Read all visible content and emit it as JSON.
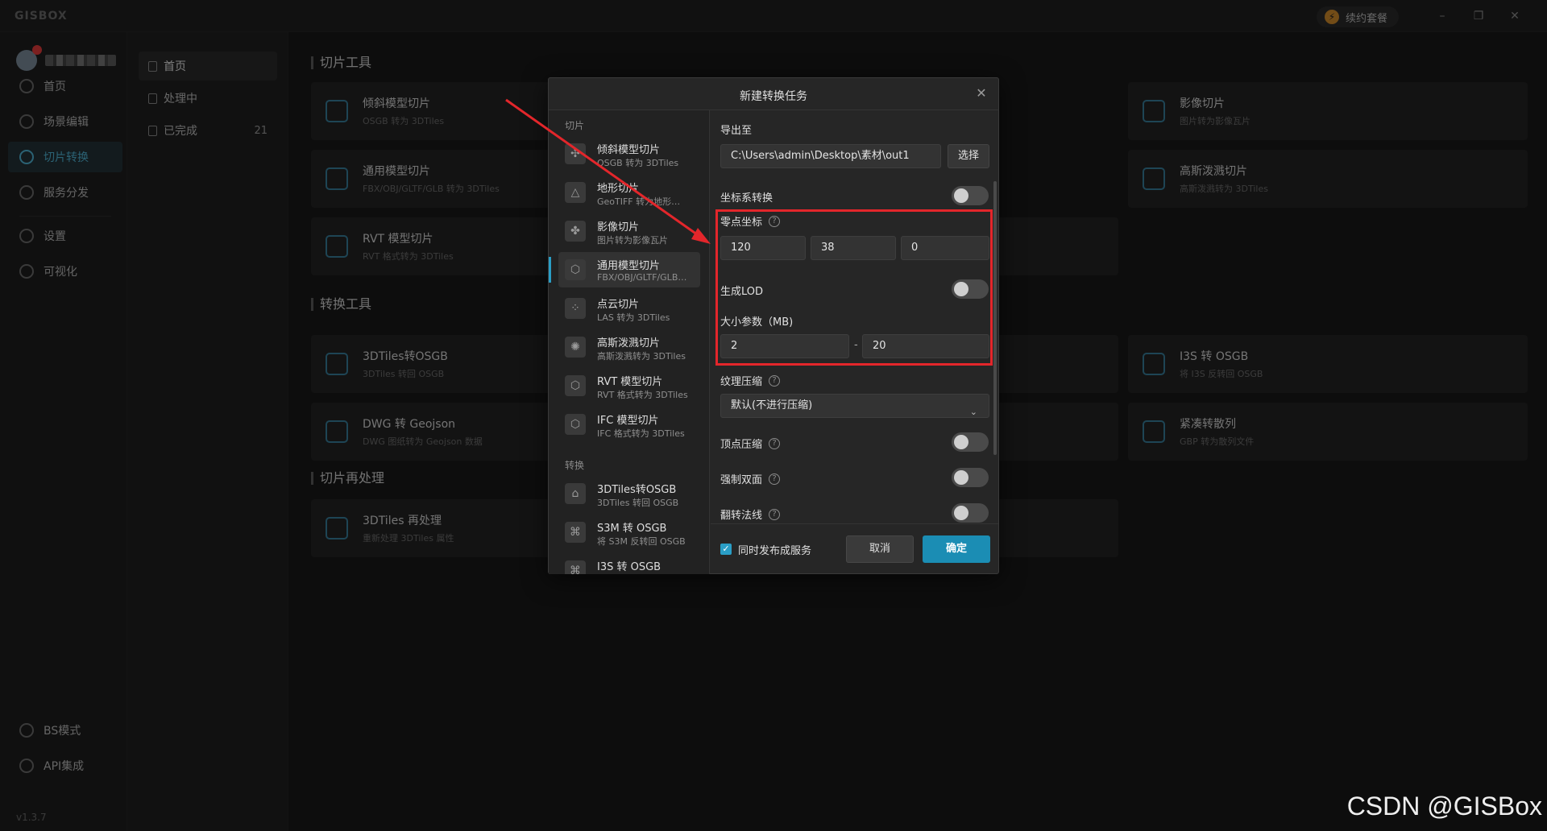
{
  "app": {
    "logo": "GISBOX",
    "renew_label": "续约套餐",
    "renew_icon": "lightning-icon",
    "version": "v1.3.7"
  },
  "left_nav": {
    "items": [
      {
        "label": "首页",
        "icon": "home-icon"
      },
      {
        "label": "场景编辑",
        "icon": "scene-icon"
      },
      {
        "label": "切片转换",
        "icon": "convert-icon",
        "active": true
      },
      {
        "label": "服务分发",
        "icon": "publish-icon"
      },
      {
        "label": "设置",
        "icon": "settings-icon"
      },
      {
        "label": "可视化",
        "icon": "visual-icon"
      }
    ],
    "bottom": [
      {
        "label": "BS模式",
        "icon": "code-icon"
      },
      {
        "label": "API集成",
        "icon": "link-icon"
      }
    ]
  },
  "sub_nav": {
    "items": [
      {
        "label": "首页",
        "active": true
      },
      {
        "label": "处理中"
      },
      {
        "label": "已完成",
        "count": "21"
      }
    ]
  },
  "main": {
    "sections": [
      "切片工具",
      "转换工具",
      "切片再处理"
    ],
    "cards": [
      {
        "title": "倾斜模型切片",
        "sub": "OSGB 转为 3DTiles"
      },
      {
        "title": "通用模型切片",
        "sub": "FBX/OBJ/GLTF/GLB 转为 3DTiles"
      },
      {
        "title": "RVT 模型切片",
        "sub": "RVT 格式转为 3DTiles"
      },
      {
        "title": "影像切片",
        "sub": "图片转为影像瓦片"
      },
      {
        "title": "高斯泼溅切片",
        "sub": "高斯泼溅转为 3DTiles"
      },
      {
        "title": "3DTiles转OSGB",
        "sub": "3DTiles 转回 OSGB"
      },
      {
        "title": "DWG 转 Geojson",
        "sub": "DWG 图纸转为 Geojson 数据"
      },
      {
        "title": "I3S 转 OSGB",
        "sub": "将 I3S 反转回 OSGB"
      },
      {
        "title": "紧凑转散列",
        "sub": "GBP 转为散列文件"
      },
      {
        "title": "3DTiles 再处理",
        "sub": "重新处理 3DTiles 属性"
      }
    ]
  },
  "dialog": {
    "title": "新建转换任务",
    "list_groups": [
      "切片",
      "转换"
    ],
    "list_items": [
      {
        "title": "倾斜模型切片",
        "sub": "OSGB 转为 3DTiles"
      },
      {
        "title": "地形切片",
        "sub": "GeoTIFF 转为地形…"
      },
      {
        "title": "影像切片",
        "sub": "图片转为影像瓦片"
      },
      {
        "title": "通用模型切片",
        "sub": "FBX/OBJ/GLTF/GLB…",
        "active": true
      },
      {
        "title": "点云切片",
        "sub": "LAS 转为 3DTiles"
      },
      {
        "title": "高斯泼溅切片",
        "sub": "高斯泼溅转为 3DTiles"
      },
      {
        "title": "RVT 模型切片",
        "sub": "RVT 格式转为 3DTiles"
      },
      {
        "title": "IFC 模型切片",
        "sub": "IFC 格式转为 3DTiles"
      },
      {
        "title": "3DTiles转OSGB",
        "sub": "3DTiles 转回 OSGB"
      },
      {
        "title": "S3M 转 OSGB",
        "sub": "将 S3M 反转回 OSGB"
      },
      {
        "title": "I3S 转 OSGB",
        "sub": ""
      }
    ],
    "form": {
      "export_label": "导出至",
      "export_path": "C:\\Users\\admin\\Desktop\\素材\\out1",
      "select_button": "选择",
      "crs_label": "坐标系转换",
      "origin_label": "零点坐标",
      "origin_values": [
        "120",
        "38",
        "0"
      ],
      "lod_label": "生成LOD",
      "size_label": "大小参数（MB)",
      "size_min": "2",
      "size_max": "20",
      "texture_label": "纹理压缩",
      "texture_value": "默认(不进行压缩)",
      "vertex_label": "顶点压缩",
      "double_label": "强制双面",
      "normal_label": "翻转法线"
    },
    "footer": {
      "publish_label": "同时发布成服务",
      "cancel": "取消",
      "ok": "确定"
    }
  },
  "colors": {
    "accent": "#1b8db4",
    "annotation": "#e3262b"
  },
  "watermark": "CSDN @GISBox"
}
